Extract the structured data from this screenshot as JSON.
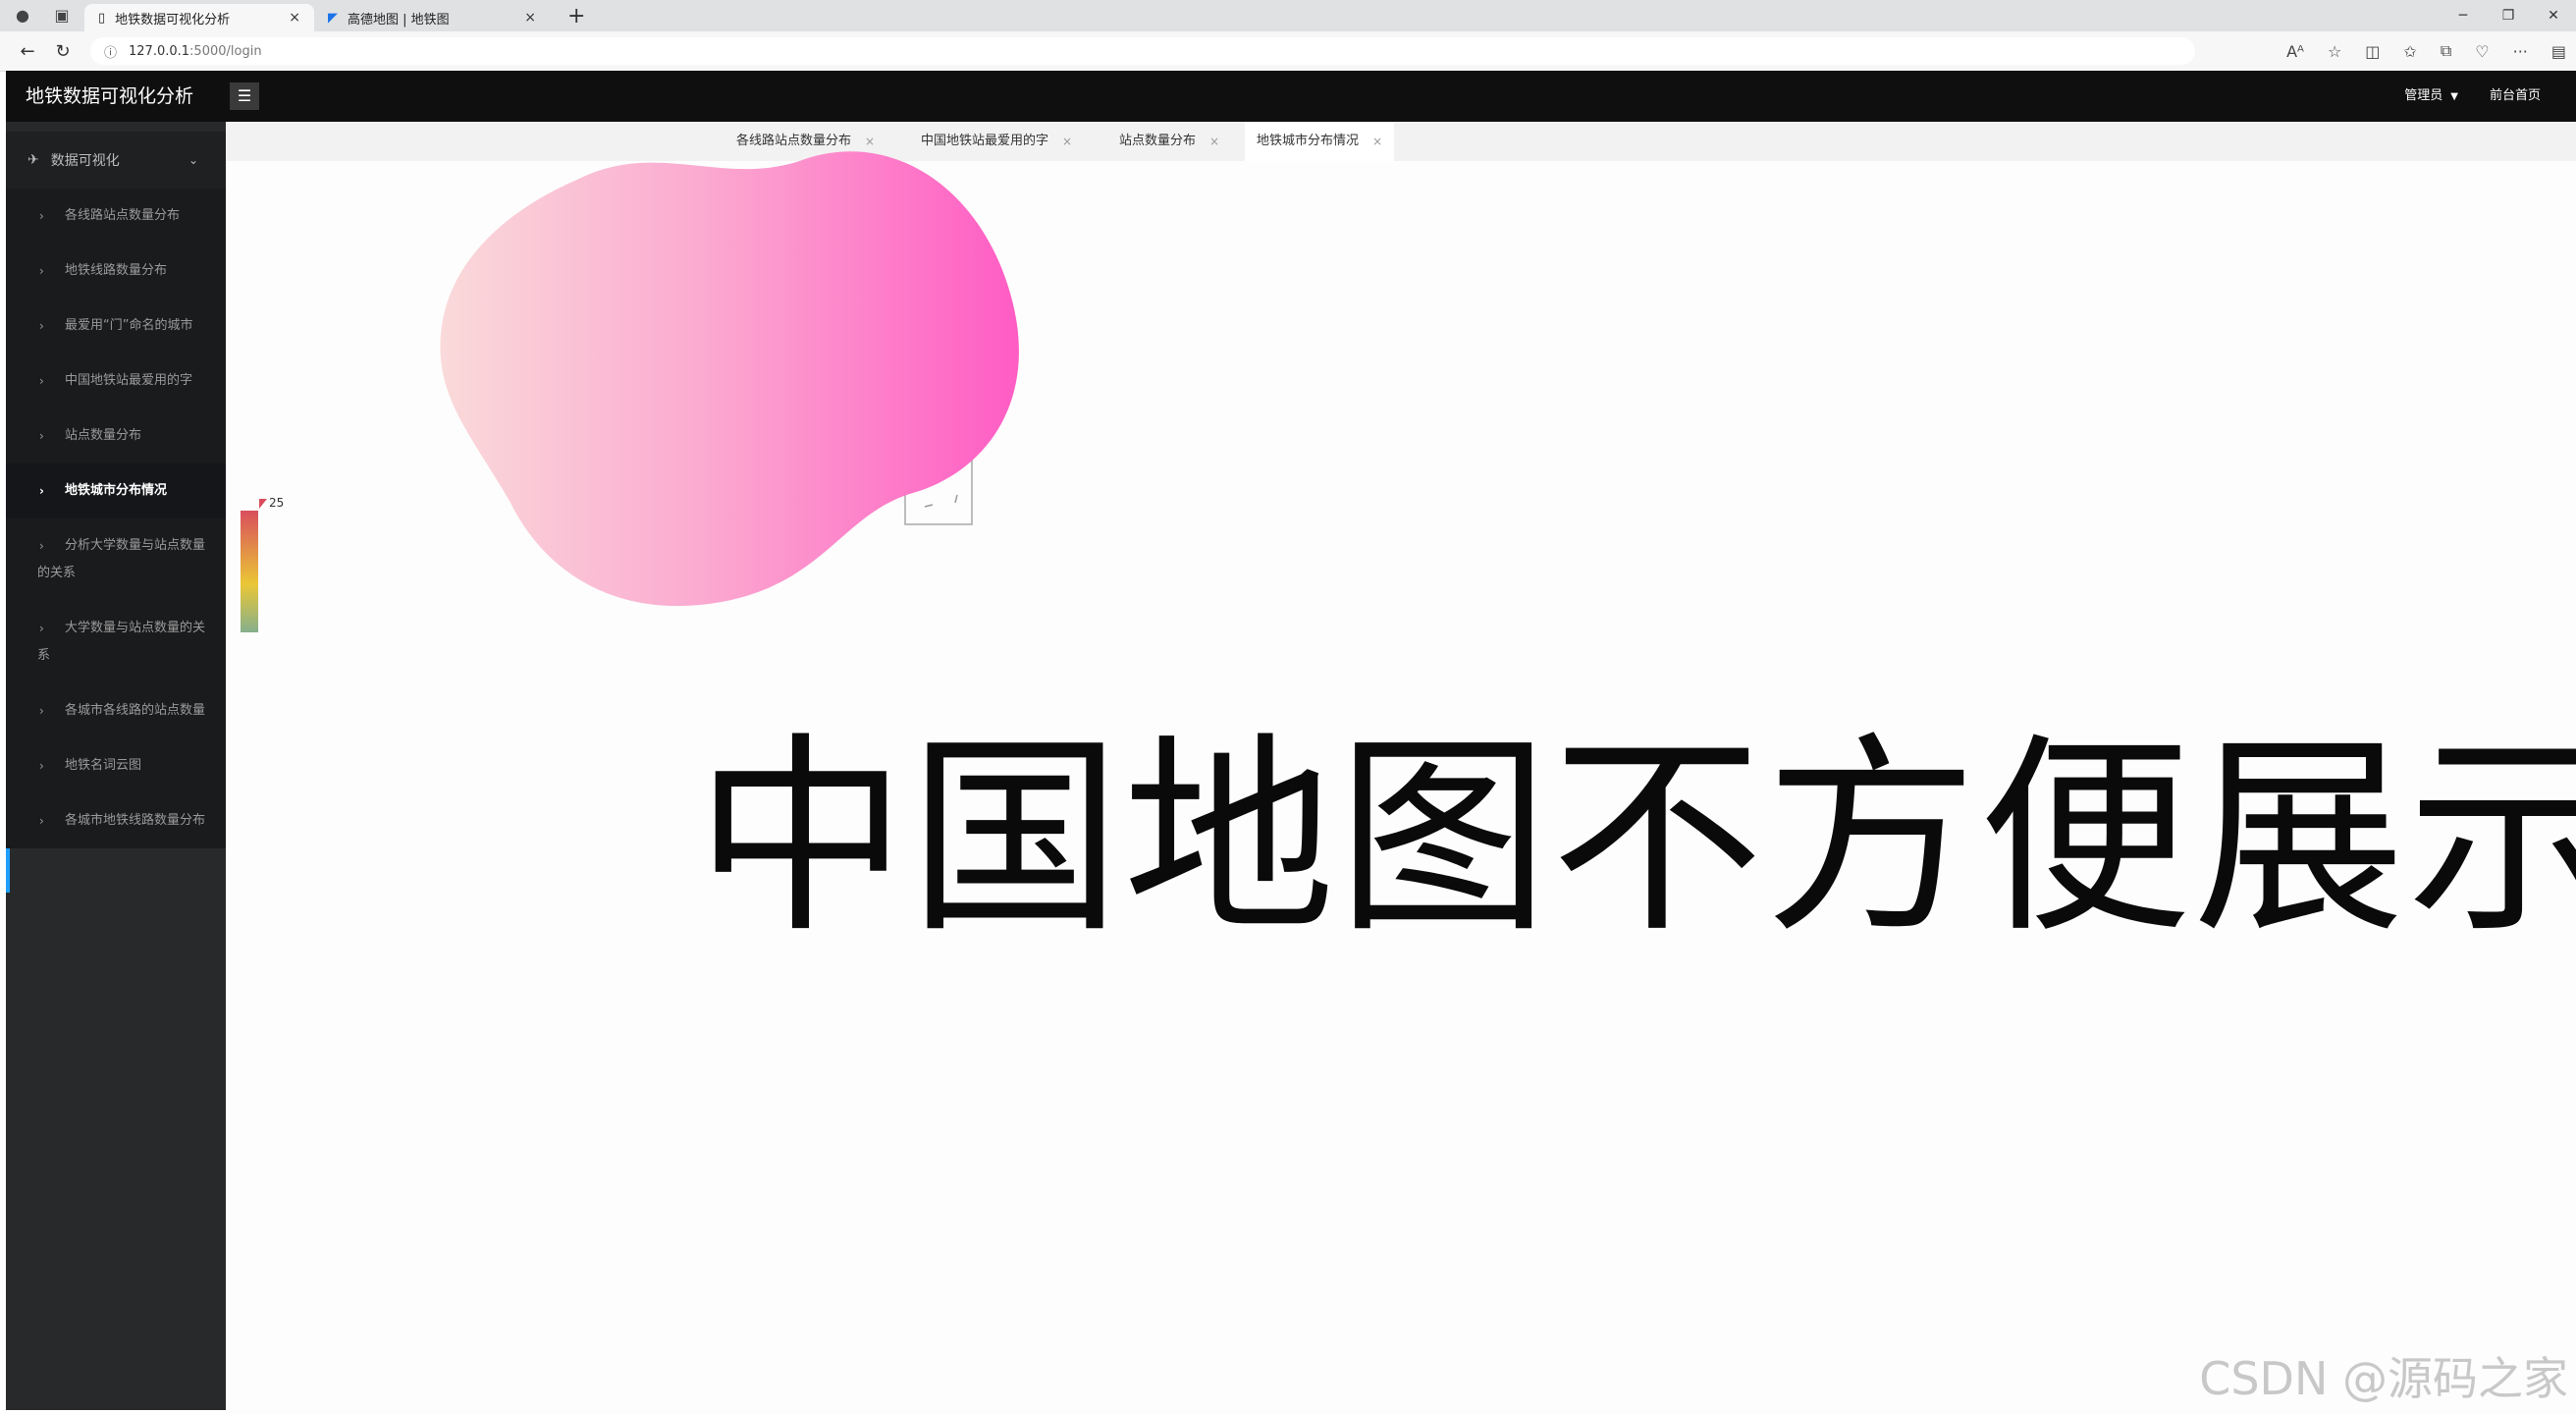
{
  "browser": {
    "tabs": [
      {
        "title": "地铁数据可视化分析",
        "close": "×"
      },
      {
        "title": "高德地图 | 地铁图",
        "close": "×"
      }
    ],
    "new_tab": "+",
    "url_host": "127.0.0.1",
    "url_path": ":5000/login"
  },
  "header": {
    "title": "地铁数据可视化分析",
    "menu_icon": "☰",
    "user": "管理员",
    "home": "前台首页"
  },
  "sidebar": {
    "group": "数据可视化",
    "items": [
      {
        "label": "各线路站点数量分布"
      },
      {
        "label": "地铁线路数量分布"
      },
      {
        "label": "最爱用“门”命名的城市"
      },
      {
        "label": "中国地铁站最爱用的字"
      },
      {
        "label": "站点数量分布"
      },
      {
        "label": "地铁城市分布情况"
      },
      {
        "label": "分析大学数量与站点数量的关系"
      },
      {
        "label": "大学数量与站点数量的关系"
      },
      {
        "label": "各城市各线路的站点数量"
      },
      {
        "label": "地铁名词云图"
      },
      {
        "label": "各城市地铁线路数量分布"
      }
    ],
    "active_index": 5
  },
  "page_tabs": [
    {
      "label": "各线路站点数量分布"
    },
    {
      "label": "中国地铁站最爱用的字"
    },
    {
      "label": "站点数量分布"
    },
    {
      "label": "地铁城市分布情况"
    }
  ],
  "map": {
    "legend_max": "25",
    "legend_min": "0",
    "colors": {
      "high": "#d94e5d",
      "mid": "#eac736",
      "low": "#50a3ba",
      "highlight": "#f5d73a"
    }
  },
  "overlay_text": "中国地图不方便展示",
  "watermark": "CSDN @源码之家"
}
